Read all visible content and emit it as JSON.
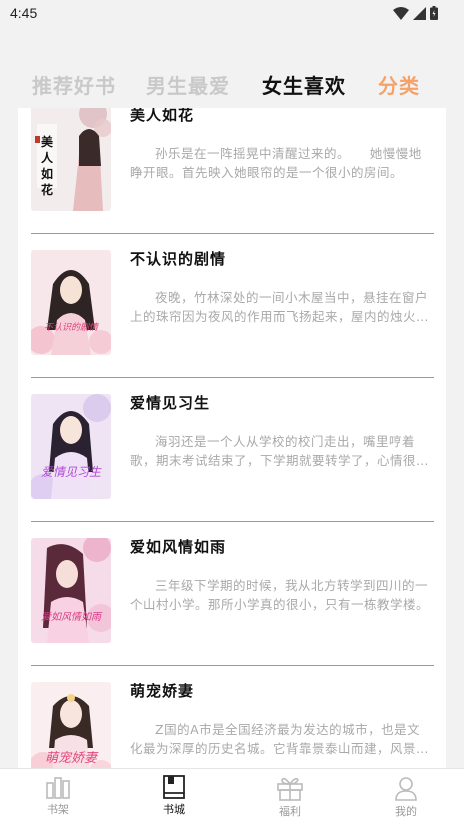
{
  "status_bar": {
    "time": "4:45",
    "icons": [
      "wifi-icon",
      "signal-icon",
      "battery-icon"
    ]
  },
  "tabs": [
    {
      "label": "推荐好书",
      "active": false
    },
    {
      "label": "男生最爱",
      "active": false
    },
    {
      "label": "女生喜欢",
      "active": true
    },
    {
      "label": "分类",
      "active": false,
      "color": "#f5a26a"
    }
  ],
  "books": [
    {
      "title": "美人如花",
      "desc": "孙乐是在一阵摇晃中清醒过来的。　　她慢慢地睁开眼。首先映入她眼帘的是一个很小的房间。"
    },
    {
      "title": "不认识的剧情",
      "desc": "夜晚，竹林深处的一间小木屋当中，悬挂在窗户上的珠帘因为夜风的作用而飞扬起来，屋内的烛火摇曳。"
    },
    {
      "title": "爱情见习生",
      "desc": "海羽还是一个人从学校的校门走出，嘴里哼着歌，期末考试结束了，下学期就要转学了，心情很好。"
    },
    {
      "title": "爱如风情如雨",
      "desc": "三年级下学期的时候，我从北方转学到四川的一个山村小学。那所小学真的很小，只有一栋教学楼。"
    },
    {
      "title": "萌宠娇妻",
      "desc": "Z国的A市是全国经济最为发达的城市，也是文化最为深厚的历史名城。它背靠景泰山而建，风景秀丽。"
    }
  ],
  "bottom_nav": [
    {
      "label": "书架",
      "icon": "bookshelf-icon",
      "active": false
    },
    {
      "label": "书城",
      "icon": "book-icon",
      "active": true
    },
    {
      "label": "福利",
      "icon": "gift-icon",
      "active": false
    },
    {
      "label": "我的",
      "icon": "user-icon",
      "active": false
    }
  ],
  "colors": {
    "accent": "#f5a26a",
    "tab_inactive": "#c9c9c9",
    "desc_text": "#a9a9a9"
  }
}
